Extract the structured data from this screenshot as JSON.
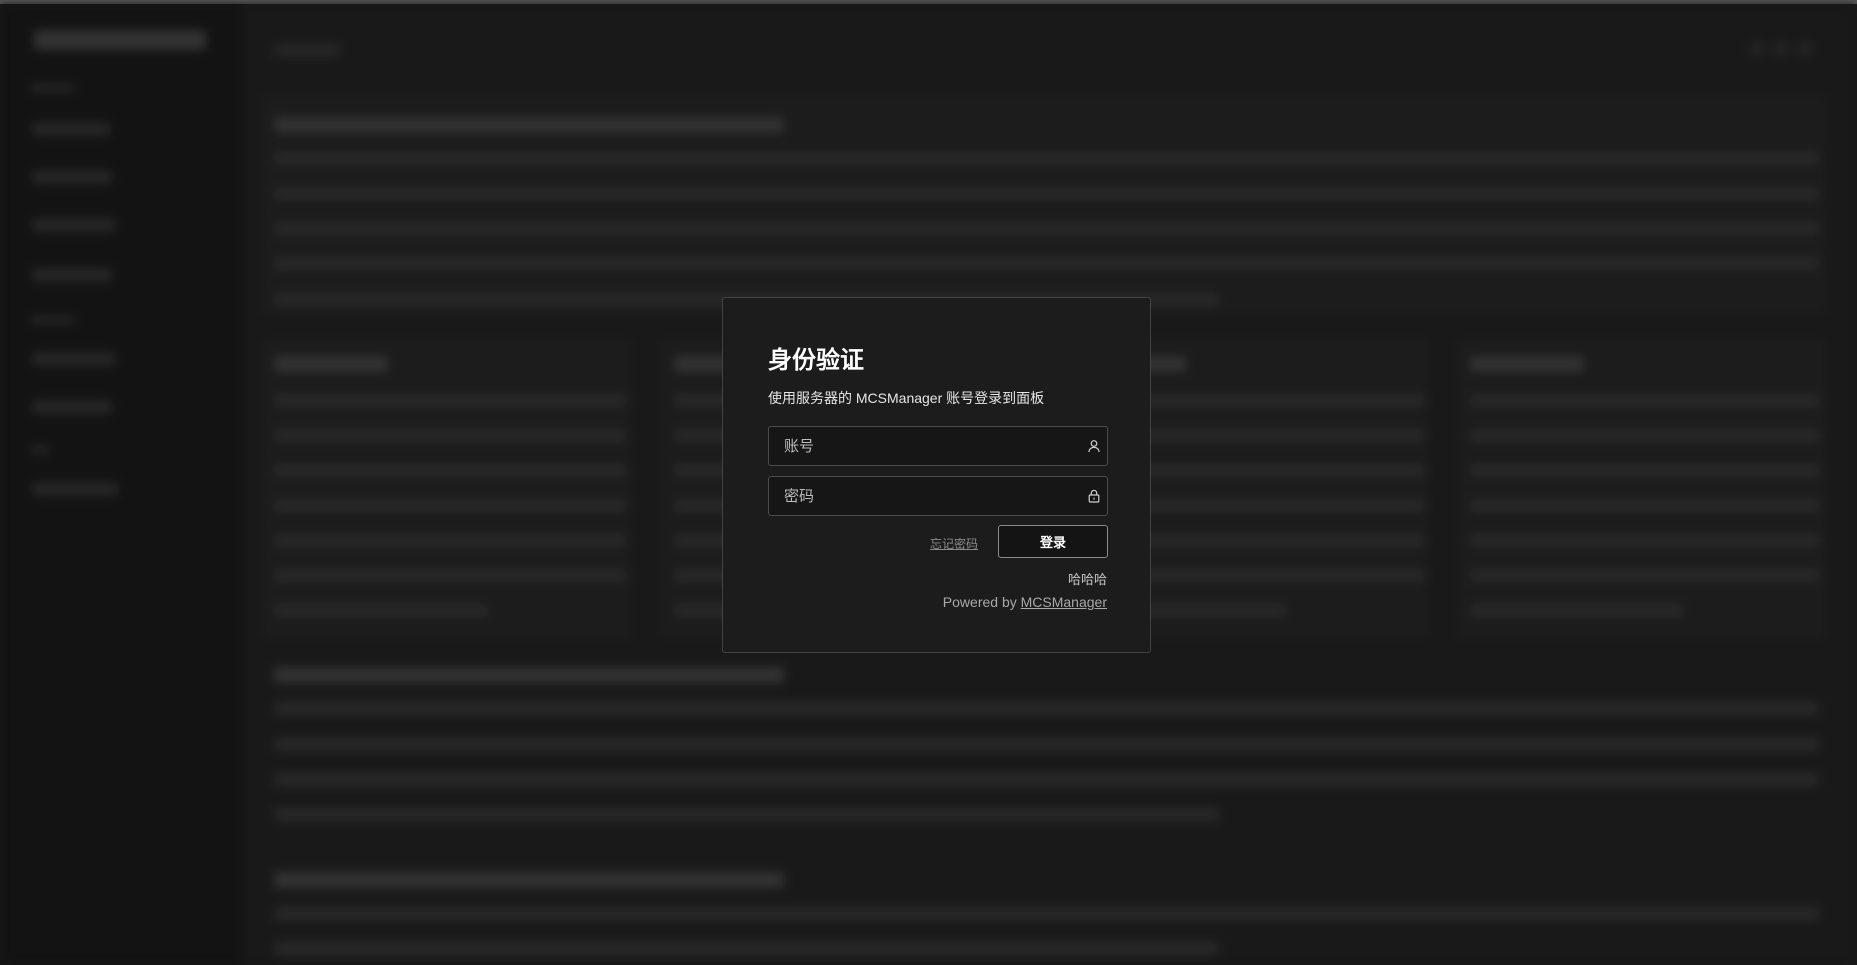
{
  "auth": {
    "title": "身份验证",
    "subtitle": "使用服务器的 MCSManager 账号登录到面板",
    "username_placeholder": "账号",
    "username_value": "",
    "password_placeholder": "密码",
    "password_value": "",
    "forgot_label": "忘记密码",
    "login_label": "登录",
    "note": "哈哈哈",
    "powered_prefix": "Powered by ",
    "powered_link": "MCSManager"
  },
  "icons": {
    "username": "user-icon",
    "password": "lock-icon"
  },
  "colors": {
    "page_background": "#1b1b1b",
    "modal_background": "#1c1c1c",
    "modal_border": "#434343",
    "button_border": "#8a8a8a"
  }
}
